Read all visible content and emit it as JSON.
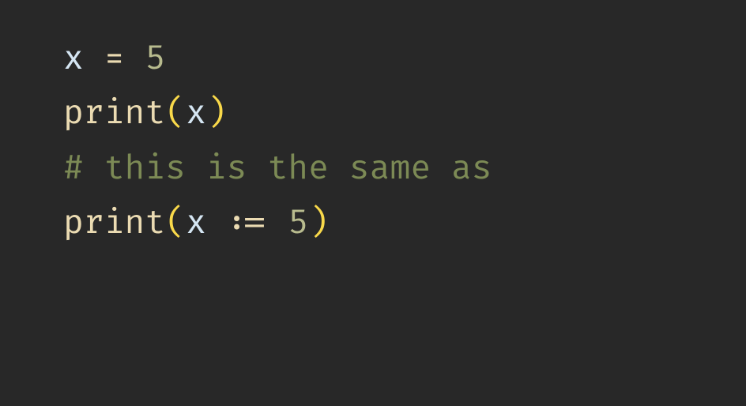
{
  "code": {
    "line1": {
      "var": "x",
      "space1": " ",
      "op": "=",
      "space2": " ",
      "num": "5"
    },
    "line2": {
      "func": "print",
      "paren_open": "(",
      "var": "x",
      "paren_close": ")"
    },
    "line3": "",
    "line4": {
      "comment": "# this is the same as"
    },
    "line5": "",
    "line6": {
      "func": "print",
      "paren_open": "(",
      "var": "x",
      "space1": " ",
      "op": ":=",
      "space2": " ",
      "num": "5",
      "paren_close": ")"
    }
  }
}
